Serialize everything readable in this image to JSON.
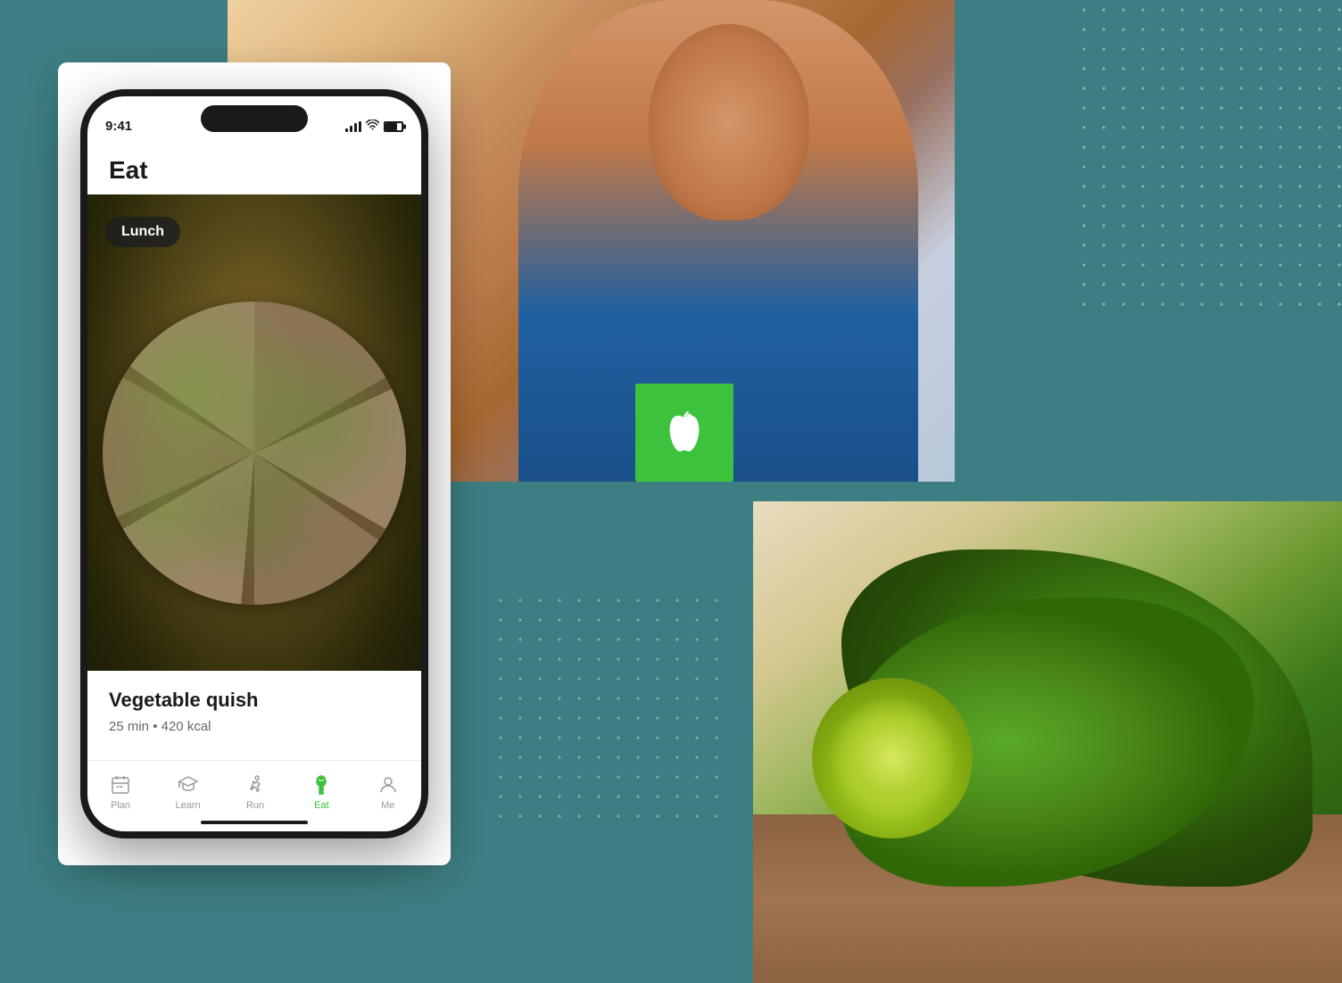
{
  "background": {
    "color": "#3d7e82"
  },
  "phone": {
    "time": "9:41",
    "title": "Eat",
    "food_label": "Lunch",
    "dish_name": "Vegetable quish",
    "dish_time": "25 min",
    "dish_calories": "420 kcal",
    "dish_meta_separator": "•",
    "nav": {
      "items": [
        {
          "id": "plan",
          "label": "Plan",
          "active": false
        },
        {
          "id": "learn",
          "label": "Learn",
          "active": false
        },
        {
          "id": "run",
          "label": "Run",
          "active": false
        },
        {
          "id": "eat",
          "label": "Eat",
          "active": true
        },
        {
          "id": "me",
          "label": "Me",
          "active": false
        }
      ]
    }
  },
  "green_box": {
    "color": "#3dc23d",
    "icon": "apple"
  },
  "dots": {
    "color": "rgba(255,255,255,0.4)"
  }
}
